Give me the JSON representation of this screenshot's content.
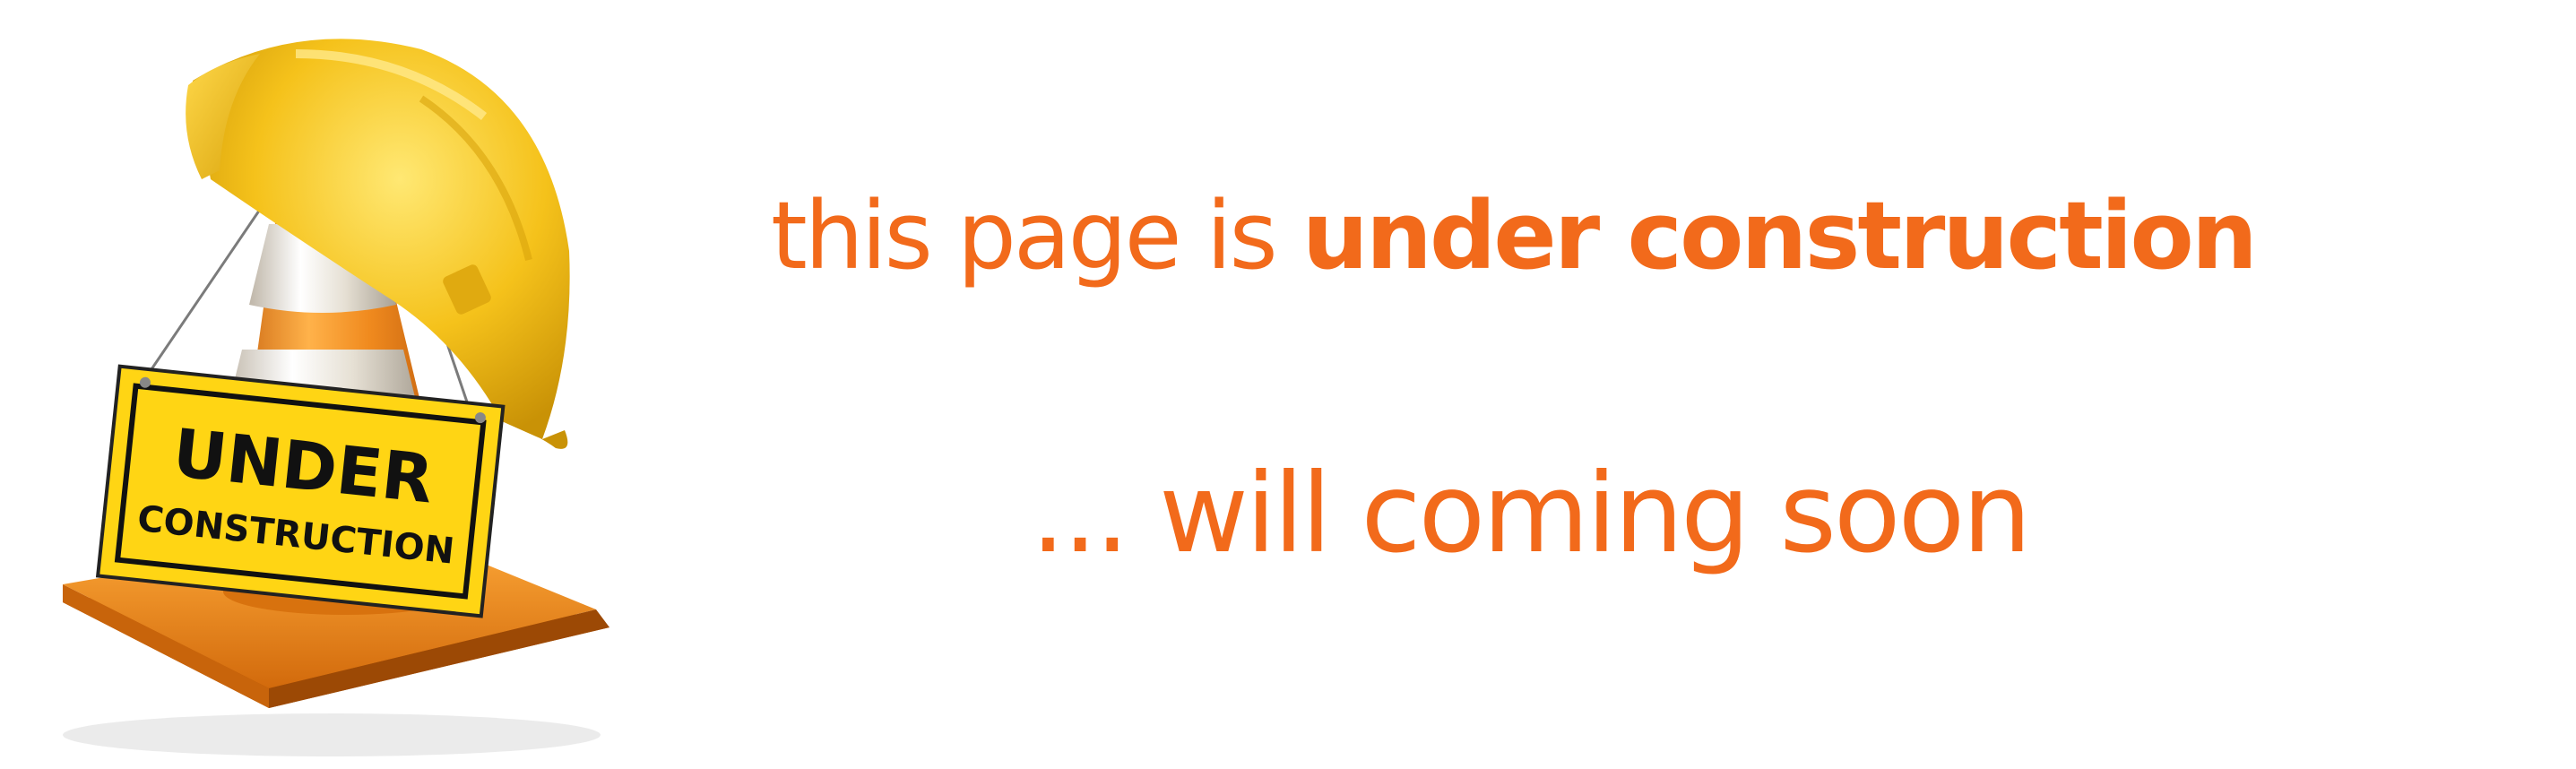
{
  "colors": {
    "text": "#f26a1b",
    "helmet": "#f5c21b",
    "cone": "#f08a1e",
    "cone_stripe": "#e8e2d6",
    "sign": "#ffd514",
    "sign_text": "#111111"
  },
  "illustration": {
    "icon": "under-construction-cone-helmet-icon",
    "sign_line1": "UNDER",
    "sign_line2": "CONSTRUCTION"
  },
  "message": {
    "headline_prefix": "this page is ",
    "headline_emphasis": "under construction",
    "subline": "... will coming soon"
  }
}
